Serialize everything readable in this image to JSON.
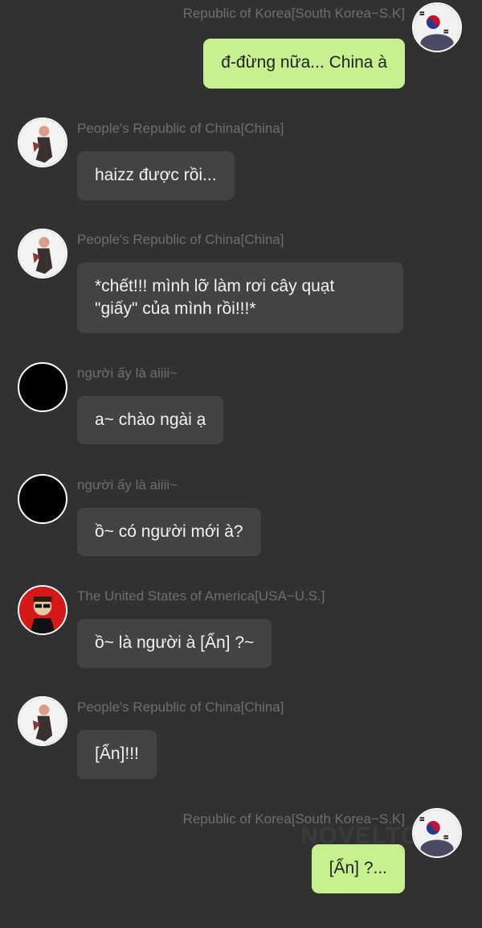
{
  "messages": [
    {
      "sender": "Republic of Korea[South Korea−S.K]",
      "text": "đ-đừng nữa... China à",
      "side": "right",
      "avatar": "korea-avatar"
    },
    {
      "sender": "People's Republic of China[China]",
      "text": "haizz được rồi...",
      "side": "left",
      "avatar": "china-avatar"
    },
    {
      "sender": "People's Republic of China[China]",
      "text": "*chết!!! mình lỡ làm rơi cây quạt\n\"giấy\" của mình rồi!!!*",
      "side": "left",
      "avatar": "china-avatar"
    },
    {
      "sender": "người ấy là aiiii~",
      "text": "a~ chào ngài ạ",
      "side": "left",
      "avatar": "black-avatar"
    },
    {
      "sender": "người ấy là aiiii~",
      "text": "ồ~ có người mới à?",
      "side": "left",
      "avatar": "black-avatar"
    },
    {
      "sender": "The United States of America[USA−U.S.]",
      "text": "ồ~ là người à [Ẩn] ?~",
      "side": "left",
      "avatar": "usa-avatar"
    },
    {
      "sender": "People's Republic of China[China]",
      "text": "[Ẩn]!!!",
      "side": "left",
      "avatar": "china-avatar"
    },
    {
      "sender": "Republic of Korea[South Korea−S.K]",
      "text": "[Ẩn] ?...",
      "side": "right",
      "avatar": "korea-avatar"
    }
  ],
  "watermark": "NOVELTO",
  "colors": {
    "background": "#313131",
    "bubble_other": "#434343",
    "bubble_self": "#c7f08f",
    "name_text": "#6e6e6e"
  }
}
